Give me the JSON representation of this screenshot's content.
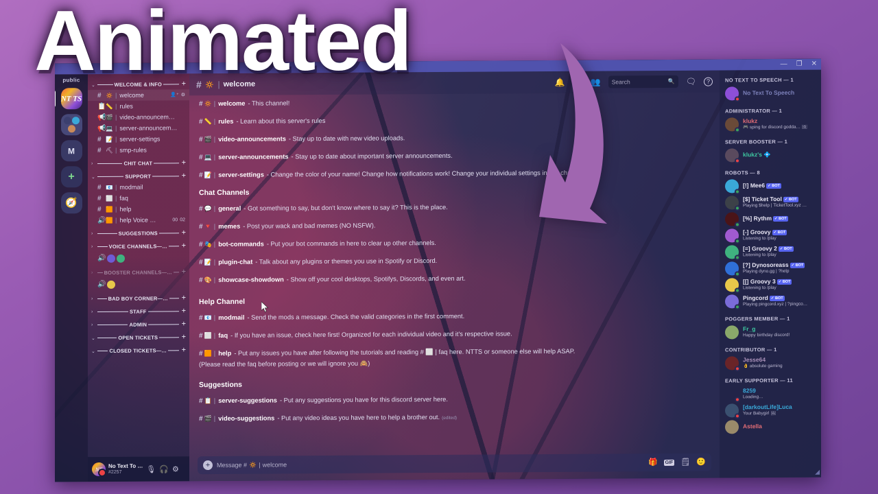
{
  "overlay": {
    "title": "Animated",
    "arrow_color": "#a066b0"
  },
  "window": {
    "controls": {
      "minimize": "—",
      "maximize": "❐",
      "close": "✕"
    }
  },
  "guild_rail": {
    "public_label": "public",
    "items": [
      {
        "name": "ntts-server",
        "label": "NT TS",
        "selected": true
      },
      {
        "name": "server-folder",
        "label": ""
      },
      {
        "name": "m-server",
        "label": "M",
        "selected": false
      },
      {
        "name": "add-server",
        "label": "+"
      },
      {
        "name": "explore-servers",
        "label": "🧭"
      }
    ]
  },
  "sidebar": {
    "categories": [
      {
        "name": "WELCOME & INFO",
        "expanded": true,
        "dim": false,
        "channels": [
          {
            "type": "text",
            "emoji": "🔅",
            "name": "welcome",
            "active": true,
            "trailing": [
              "invite",
              "gear"
            ]
          },
          {
            "type": "rules",
            "emoji": "📏",
            "name": "rules",
            "active": false,
            "trailing": []
          },
          {
            "type": "announcement",
            "emoji": "🎬",
            "name": "video-announceme…",
            "active": false,
            "trailing": []
          },
          {
            "type": "announcement",
            "emoji": "💻",
            "name": "server-announcem…",
            "active": false,
            "trailing": []
          },
          {
            "type": "text",
            "emoji": "📝",
            "name": "server-settings",
            "active": false,
            "trailing": []
          },
          {
            "type": "text",
            "emoji": "⛏",
            "name": "smp-rules",
            "active": false,
            "trailing": []
          }
        ]
      },
      {
        "name": "CHIT CHAT",
        "expanded": false,
        "dim": false,
        "channels": []
      },
      {
        "name": "SUPPORT",
        "expanded": true,
        "dim": false,
        "channels": [
          {
            "type": "text",
            "emoji": "📧",
            "name": "modmail",
            "active": false,
            "trailing": []
          },
          {
            "type": "text",
            "emoji": "⬜",
            "name": "faq",
            "active": false,
            "trailing": []
          },
          {
            "type": "text",
            "emoji": "🟧",
            "name": "help",
            "active": false,
            "trailing": []
          },
          {
            "type": "voice",
            "emoji": "🟧",
            "name": "help Voice …",
            "active": false,
            "trailing": [
              "00",
              "02"
            ]
          }
        ]
      },
      {
        "name": "SUGGESTIONS",
        "expanded": false,
        "dim": false,
        "channels": []
      },
      {
        "name": "VOICE CHANNELS—…",
        "expanded": false,
        "dim": false,
        "channels": [],
        "voice_avatars": [
          "#6f5bd6",
          "#3fb27f"
        ]
      },
      {
        "name": "BOOSTER CHANNELS—…",
        "expanded": false,
        "dim": true,
        "channels": [],
        "voice_avatars": [
          "#e8c84a"
        ]
      },
      {
        "name": "BAD BOY CORNER—…",
        "expanded": false,
        "dim": false,
        "channels": []
      },
      {
        "name": "STAFF",
        "expanded": false,
        "dim": false,
        "channels": []
      },
      {
        "name": "ADMIN",
        "expanded": false,
        "dim": false,
        "channels": []
      },
      {
        "name": "OPEN TICKETS",
        "expanded": true,
        "dim": false,
        "channels": []
      },
      {
        "name": "CLOSED TICKETS—…",
        "expanded": true,
        "dim": false,
        "channels": []
      }
    ],
    "add_label": "+",
    "caret_expanded": "⌄",
    "caret_collapsed": "›"
  },
  "user_panel": {
    "display_name": "No Text To …",
    "tag": "#2257",
    "avatar_text": "NT",
    "controls": [
      {
        "name": "mute-microphone",
        "glyph": "🎙"
      },
      {
        "name": "deafen",
        "glyph": "🎧"
      },
      {
        "name": "user-settings",
        "glyph": "⚙"
      }
    ]
  },
  "chat_header": {
    "hash": "#",
    "emoji": "🔅",
    "pipe": "|",
    "channel": "welcome",
    "search_placeholder": "Search",
    "icons": [
      {
        "name": "notifications-bell-icon",
        "glyph": "🔔"
      },
      {
        "name": "pinned-messages-icon",
        "glyph": "📌"
      },
      {
        "name": "member-list-icon",
        "glyph": "👥"
      },
      {
        "name": "inbox-icon",
        "glyph": "🗨"
      },
      {
        "name": "help-icon",
        "glyph": "?"
      }
    ],
    "search_icon": "🔍"
  },
  "messages": {
    "lines": [
      {
        "hash": "#",
        "emoji": "🔅",
        "pipe": "|",
        "channel": "welcome",
        "desc": "- This channel!"
      },
      {
        "hash": "#",
        "emoji": "📏",
        "pipe": "|",
        "channel": "rules",
        "desc": "- Learn about this server's rules"
      },
      {
        "hash": "#",
        "emoji": "🎬",
        "pipe": "|",
        "channel": "video-announcements",
        "desc": "- Stay up to date with new video uploads."
      },
      {
        "hash": "#",
        "emoji": "💻",
        "pipe": "|",
        "channel": "server-announcements",
        "desc": "- Stay up to date about important server announcements."
      },
      {
        "hash": "#",
        "emoji": "📝",
        "pipe": "|",
        "channel": "server-settings",
        "desc": "- Change the color of your name! Change how notifications work! Change your individual settings in this channel."
      }
    ],
    "section_chat": "Chat Channels",
    "chat_lines": [
      {
        "hash": "#",
        "emoji": "💬",
        "pipe": "|",
        "channel": "general",
        "desc": "- Got something to say, but don't know where to say it? This is the place."
      },
      {
        "hash": "#",
        "emoji": "🔻",
        "pipe": "|",
        "channel": "memes",
        "desc": "- Post your wack and bad memes (NO NSFW)."
      },
      {
        "hash": "#",
        "emoji": "🎭",
        "pipe": "|",
        "channel": "bot-commands",
        "desc": "- Put your bot commands in here to clear up other channels."
      },
      {
        "hash": "#",
        "emoji": "📝",
        "pipe": "|",
        "channel": "plugin-chat",
        "desc": "- Talk about any plugins or themes you use in Spotify or Discord."
      },
      {
        "hash": "#",
        "emoji": "🎨",
        "pipe": "|",
        "channel": "showcase-showdown",
        "desc": "- Show off your cool desktops, Spotifys, Discords, and even art."
      }
    ],
    "section_help": "Help Channel",
    "help_lines": [
      {
        "hash": "#",
        "emoji": "📧",
        "pipe": "|",
        "channel": "modmail",
        "desc": "- Send the mods a message. Check the valid categories in the first comment."
      },
      {
        "hash": "#",
        "emoji": "⬜",
        "pipe": "|",
        "channel": "faq",
        "desc": "- If you have an issue, check here first! Organized for each individual video and it's respective issue."
      },
      {
        "hash": "#",
        "emoji": "🟧",
        "pipe": "|",
        "channel": "help",
        "desc": "- Put any issues you have after following the tutorials and reading # ⬜ | faq here. NTTS or someone else will help ASAP."
      }
    ],
    "help_continuation": "(Please read the faq before posting or we will ignore you 🙈)",
    "section_suggestions": "Suggestions",
    "suggestion_lines": [
      {
        "hash": "#",
        "emoji": "📋",
        "pipe": "|",
        "channel": "server-suggestions",
        "desc": "- Put any suggestions you have for this discord server here.",
        "edited": ""
      },
      {
        "hash": "#",
        "emoji": "🎬",
        "pipe": "|",
        "channel": "video-suggestions",
        "desc": "- Put any video ideas you have here to help a brother out.",
        "edited": "(edited)"
      }
    ]
  },
  "composer": {
    "plus": "+",
    "placeholder_prefix": "Message #",
    "placeholder_emoji": "🔅",
    "placeholder_pipe": "|",
    "placeholder_channel": "welcome",
    "icons": [
      {
        "name": "gift-icon",
        "glyph": "🎁"
      },
      {
        "name": "gif-icon",
        "glyph": "GIF"
      },
      {
        "name": "sticker-icon",
        "glyph": "🗒"
      },
      {
        "name": "emoji-icon",
        "glyph": "🙂"
      }
    ]
  },
  "members": {
    "groups": [
      {
        "title": "NO TEXT TO SPEECH — 1",
        "rows": [
          {
            "name": "No Text To Speech",
            "status": "",
            "color": "#7b7fb8",
            "avatar": "#8d4fd8",
            "presence": "dnd",
            "bot": false
          }
        ]
      },
      {
        "title": "ADMINISTRATOR — 1",
        "rows": [
          {
            "name": "klukz",
            "status": "🎮 sping for discord godda… 🖼",
            "color": "#e06c75",
            "avatar": "#6a4a38",
            "presence": "online",
            "bot": false
          }
        ]
      },
      {
        "title": "SERVER BOOSTER — 1",
        "rows": [
          {
            "name": "klukz's 💠",
            "status": "",
            "color": "#3ec6a0",
            "avatar": "#5a4a5e",
            "presence": "dnd",
            "bot": false
          }
        ]
      },
      {
        "title": "ROBOTS — 8",
        "rows": [
          {
            "name": "[!] Mee6",
            "status": "",
            "color": "#e8e6f4",
            "avatar": "#3aa8d8",
            "presence": "online",
            "bot": true
          },
          {
            "name": "[$] Ticket Tool",
            "status": "Playing $help | TicketTool.xyz …",
            "color": "#e8e6f4",
            "avatar": "#3c4148",
            "presence": "online",
            "bot": true
          },
          {
            "name": "[%] Rythm",
            "status": "",
            "color": "#e8e6f4",
            "avatar": "#4a1418",
            "presence": "online",
            "bot": true
          },
          {
            "name": "[-] Groovy",
            "status": "Listening to /play",
            "color": "#e8e6f4",
            "avatar": "#a05ad0",
            "presence": "online",
            "bot": true
          },
          {
            "name": "[=] Groovy 2",
            "status": "Listening to /play",
            "color": "#e8e6f4",
            "avatar": "#3fb27f",
            "presence": "online",
            "bot": true
          },
          {
            "name": "[?] Dynosoreass",
            "status": "Playing dyno.gg | ?help",
            "color": "#e8e6f4",
            "avatar": "#2f6fd8",
            "presence": "online",
            "bot": true
          },
          {
            "name": "[[] Groovy 3",
            "status": "Listening to /play",
            "color": "#e8e6f4",
            "avatar": "#e8c84a",
            "presence": "online",
            "bot": true
          },
          {
            "name": "Pingcord",
            "status": "Playing pingcord.xyz | ?pingco…",
            "color": "#e8e6f4",
            "avatar": "#7a6cd8",
            "presence": "online",
            "bot": true
          }
        ]
      },
      {
        "title": "POGGERS MEMBER — 1",
        "rows": [
          {
            "name": "Fr_g",
            "status": "Happy birthday discord!",
            "color": "#3ec6a0",
            "avatar": "#8aa86a",
            "presence": "",
            "bot": false
          }
        ]
      },
      {
        "title": "CONTRIBUTOR — 1",
        "rows": [
          {
            "name": "Jesse64",
            "status": "👌 absolute gaming",
            "color": "#a88fb8",
            "avatar": "#6a2428",
            "presence": "dnd",
            "bot": false
          }
        ]
      },
      {
        "title": "EARLY SUPPORTER — 11",
        "rows": [
          {
            "name": "8259",
            "status": "Loading…",
            "color": "#3aa8d8",
            "avatar": "transparent",
            "presence": "dnd",
            "bot": false
          },
          {
            "name": "[darkoutLife]Luca",
            "status": "Your Babygirl 🖼",
            "color": "#3aa8d8",
            "avatar": "#3a5070",
            "presence": "dnd",
            "bot": false
          },
          {
            "name": "Astella",
            "status": "",
            "color": "#e06c75",
            "avatar": "#9a8a6a",
            "presence": "",
            "bot": false
          }
        ]
      }
    ],
    "bot_tag": "BOT",
    "bot_check": "✓"
  }
}
